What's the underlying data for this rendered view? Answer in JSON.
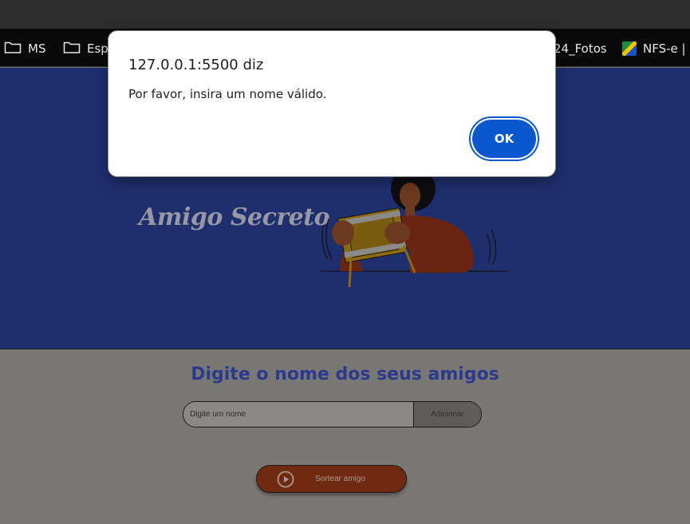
{
  "bookmarks": [
    {
      "label": "MS",
      "icon": "folder-icon"
    },
    {
      "label": "Espa",
      "icon": "folder-icon"
    },
    {
      "label": "24_Fotos",
      "icon": "none"
    },
    {
      "label": "NFS-e | P",
      "icon": "nfse-logo-icon"
    }
  ],
  "hero": {
    "title": "Amigo Secreto",
    "illustration": "person-holding-gift-illustration"
  },
  "main": {
    "heading": "Digite o nome dos seus amigos",
    "input_placeholder": "Digite um nome",
    "add_label": "Adicionar",
    "draw_label": "Sortear amigo",
    "draw_icon": "play-circle-icon"
  },
  "dialog": {
    "title": "127.0.0.1:5500 diz",
    "message": "Por favor, insira um nome válido.",
    "ok_label": "OK"
  },
  "colors": {
    "hero_bg": "#1f2f6e",
    "heading": "#2c3a8e",
    "draw_button": "#6f2a10",
    "ok_button": "#0b57d0"
  }
}
